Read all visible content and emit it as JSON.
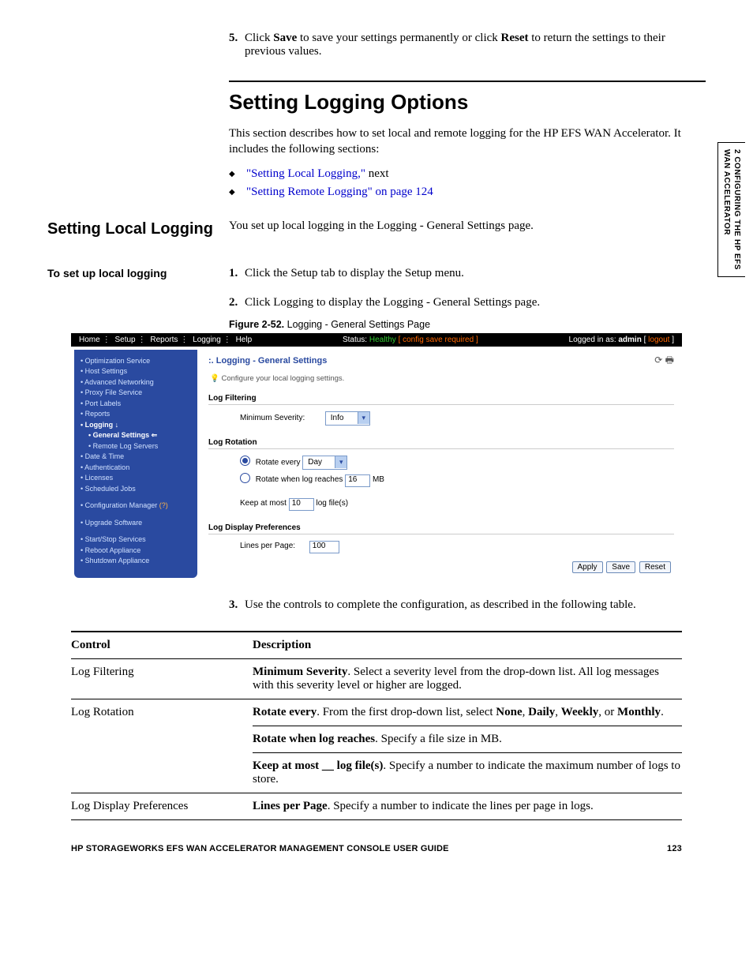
{
  "sideTab": {
    "line1": "2  CONFIGURING THE HP EFS",
    "line2": "WAN ACCELERATOR"
  },
  "topStep": {
    "num": "5.",
    "pre": "Click ",
    "b1": "Save",
    "mid": " to save your settings permanently or click ",
    "b2": "Reset",
    "post": " to return the settings to their previous values."
  },
  "h1": "Setting Logging Options",
  "intro": "This section describes how to set local and remote logging for the HP EFS WAN Accelerator. It includes the following sections:",
  "bullets": {
    "b1a": "\"Setting Local Logging,\"",
    "b1b": " next",
    "b2": "\"Setting Remote Logging\" on page 124"
  },
  "leftHead": "Setting Local Logging",
  "rightPara": "You set up local logging in the Logging - General Settings page.",
  "leftSub": "To set up local logging",
  "steps": {
    "s1": {
      "n": "1.",
      "t": "Click the Setup tab to display the Setup menu."
    },
    "s2": {
      "n": "2.",
      "t": "Click Logging to display the Logging - General Settings page."
    },
    "s3": {
      "n": "3.",
      "t": "Use the controls to complete the configuration, as described in the following table."
    }
  },
  "figCaption": {
    "b": "Figure 2-52.",
    "t": " Logging - General Settings Page"
  },
  "shot": {
    "nav": [
      "Home",
      "Setup",
      "Reports",
      "Logging",
      "Help"
    ],
    "statusLabel": "Status:",
    "statusVal": "Healthy",
    "statusWarn": "[ config save required ]",
    "loginPre": "Logged in as: ",
    "loginUser": "admin",
    "loginPost": " [ ",
    "logout": "logout",
    "loginEnd": " ]",
    "side": {
      "g1": [
        "• Optimization Service",
        "• Host Settings",
        "• Advanced Networking",
        "• Proxy File Service",
        "• Port Labels",
        "• Reports"
      ],
      "logging": "• Logging ↓",
      "loggingSubs": [
        "• General Settings ⇐",
        "• Remote Log Servers"
      ],
      "g1b": [
        "• Date & Time",
        "• Authentication",
        "• Licenses",
        "• Scheduled Jobs"
      ],
      "cfg": "• Configuration Manager ",
      "cfgQ": "(?)",
      "upg": "• Upgrade Software",
      "g3": [
        "• Start/Stop Services",
        "• Reboot Appliance",
        "• Shutdown Appliance"
      ]
    },
    "main": {
      "title": ":. Logging - General Settings",
      "tip": "Configure your local logging settings.",
      "sect1": "Log Filtering",
      "minSevLabel": "Minimum Severity:",
      "minSevVal": "Info",
      "sect2": "Log Rotation",
      "rotEveryLabel": "Rotate every",
      "rotEveryVal": "Day",
      "rotWhenLabel": "Rotate when log reaches",
      "rotWhenVal": "16",
      "rotWhenUnit": "MB",
      "keepLabel": "Keep at most",
      "keepVal": "10",
      "keepUnit": "log file(s)",
      "sect3": "Log Display Preferences",
      "lppLabel": "Lines per Page:",
      "lppVal": "100",
      "btnApply": "Apply",
      "btnSave": "Save",
      "btnReset": "Reset"
    }
  },
  "table": {
    "h1": "Control",
    "h2": "Description",
    "r1c1": "Log Filtering",
    "r1c2b": "Minimum Severity",
    "r1c2t": ". Select a severity level from the drop-down list. All log messages with this severity level or higher are logged.",
    "r2c1": "Log Rotation",
    "r2a_b": "Rotate every",
    "r2a_t1": ". From the first drop-down list, select ",
    "r2a_n": "None",
    "r2a_c1": ", ",
    "r2a_d": "Daily",
    "r2a_c2": ", ",
    "r2a_w": "Weekly",
    "r2a_c3": ", or ",
    "r2a_m": "Monthly",
    "r2a_end": ".",
    "r2b_b": "Rotate when log reaches",
    "r2b_t": ". Specify a file size in MB.",
    "r2c_b": "Keep at most __ log file(s)",
    "r2c_t": ". Specify a number to indicate the maximum number of logs to store.",
    "r3c1": "Log Display Preferences",
    "r3b": "Lines per Page",
    "r3t": ". Specify a number to indicate the lines per page in logs."
  },
  "footer": {
    "title": "HP STORAGEWORKS EFS WAN ACCELERATOR MANAGEMENT CONSOLE USER GUIDE",
    "page": "123"
  }
}
